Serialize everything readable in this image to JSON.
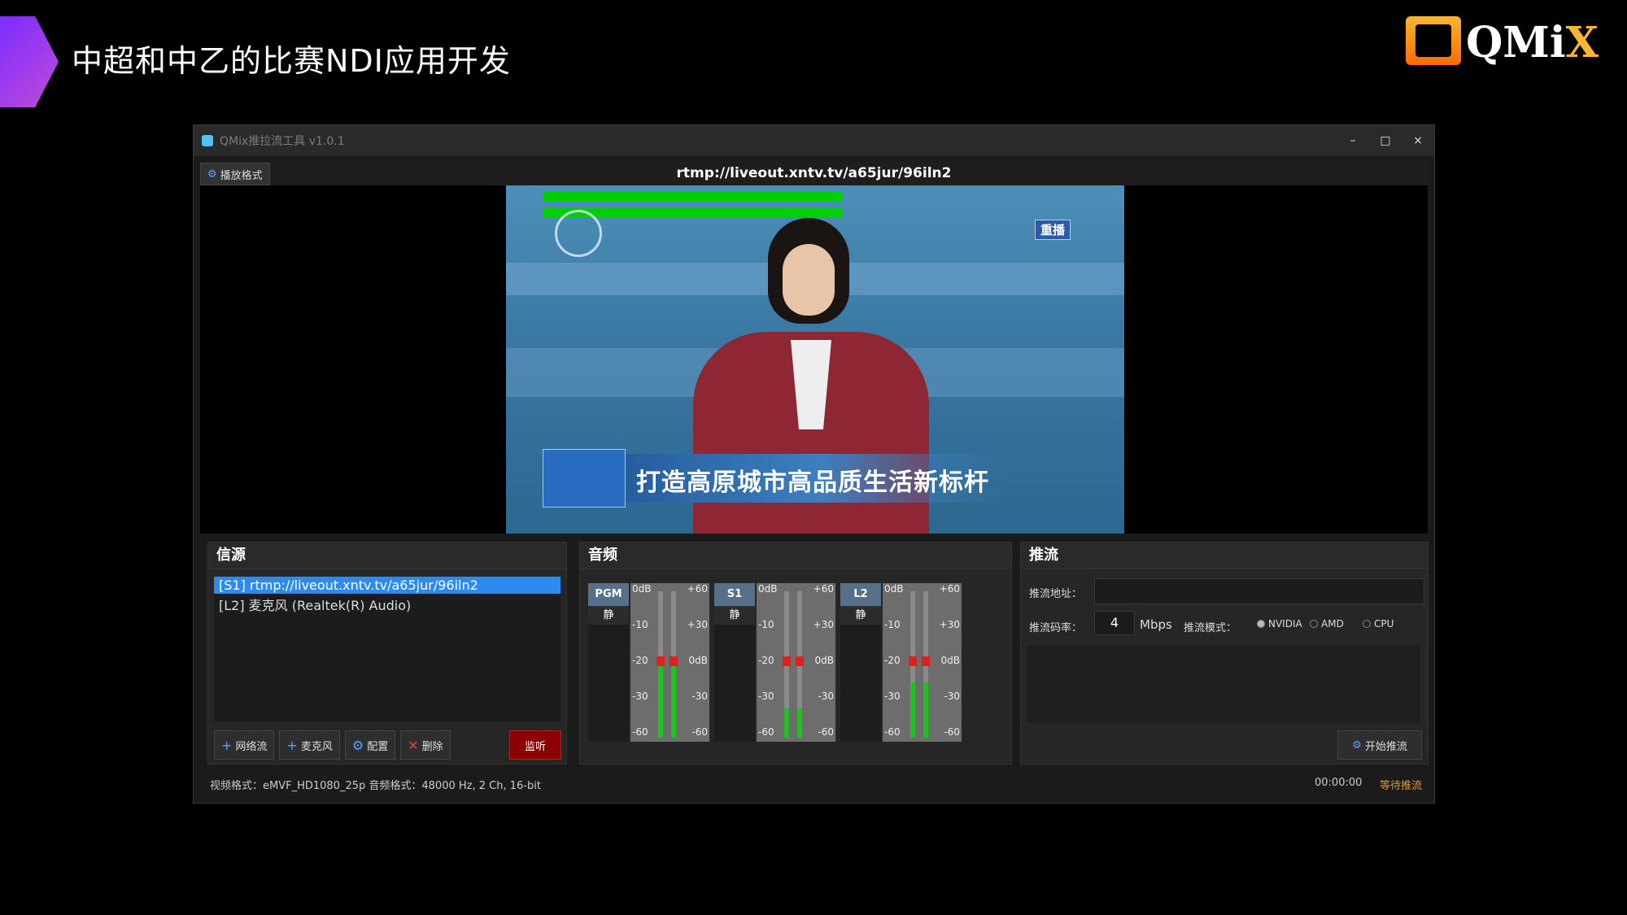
{
  "slide": {
    "title": "中超和中乙的比赛NDI应用开发",
    "logo_text": "QMiX"
  },
  "window": {
    "title": "QMix推拉流工具 v1.0.1",
    "controls": [
      "–",
      "□",
      "×"
    ]
  },
  "toolbar": {
    "format_button": "播放格式",
    "url": "rtmp://liveout.xntv.tv/a65jur/96iln2"
  },
  "preview": {
    "live_badge": "重播",
    "lower_third": "打造高原城市高品质生活新标杆"
  },
  "source_panel": {
    "title": "信源",
    "items": [
      {
        "label": "[S1] rtmp://liveout.xntv.tv/a65jur/96iln2",
        "selected": true
      },
      {
        "label": "[L2] 麦克风 (Realtek(R) Audio)",
        "selected": false
      }
    ],
    "buttons": {
      "network": "网络流",
      "mic": "麦克风",
      "config": "配置",
      "delete": "删除",
      "monitor": "监听"
    }
  },
  "audio_panel": {
    "title": "音频",
    "scale_left": [
      "0dB",
      "-10",
      "-20",
      "-30",
      "-60"
    ],
    "scale_right": [
      "+60",
      "+30",
      "0dB",
      "-30",
      "-60"
    ],
    "strips": [
      {
        "name": "PGM",
        "mute": "静",
        "levels": [
          0.55,
          0.55
        ]
      },
      {
        "name": "S1",
        "mute": "静",
        "levels": [
          0.2,
          0.2
        ]
      },
      {
        "name": "L2",
        "mute": "静",
        "levels": [
          0.38,
          0.38
        ]
      }
    ]
  },
  "stream_panel": {
    "title": "推流",
    "address_label": "推流地址：",
    "address_value": "",
    "bitrate_label": "推流码率：",
    "bitrate_value": "4",
    "bitrate_unit": "Mbps",
    "mode_label": "推流模式：",
    "modes": [
      {
        "label": "NVIDIA",
        "selected": true
      },
      {
        "label": "AMD",
        "selected": false
      },
      {
        "label": "CPU",
        "selected": false
      }
    ],
    "start_button": "开始推流"
  },
  "status": {
    "info": "视频格式：eMVF_HD1080_25p  音频格式：48000 Hz, 2 Ch, 16-bit",
    "time": "00:00:00",
    "state": "等待推流"
  },
  "colors": {
    "accent": "#2c8bf0",
    "meter_green": "#1fc21f",
    "fader_red": "#e02020",
    "monitor_red": "#8b0000",
    "status_orange": "#e09a30"
  }
}
